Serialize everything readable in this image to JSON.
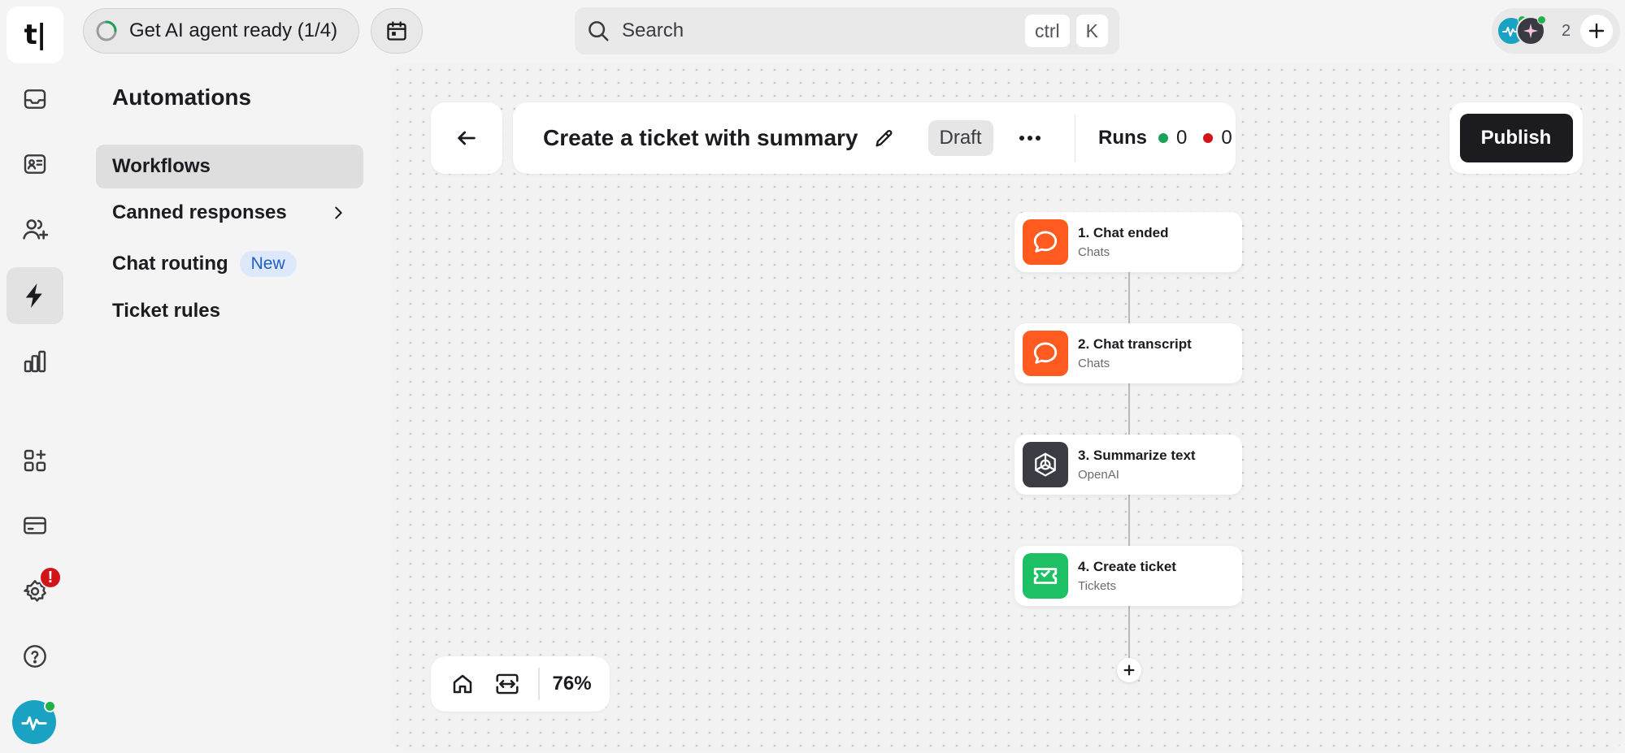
{
  "app": {
    "logo_text": "t|"
  },
  "topbar": {
    "onboarding_label": "Get AI agent ready (1/4)",
    "onboarding_progress": 0.25,
    "search_placeholder": "Search",
    "shortcut_keys": [
      "ctrl",
      "K"
    ],
    "presence_count": "2"
  },
  "rail": {
    "items": [
      {
        "name": "inbox-icon",
        "active": false
      },
      {
        "name": "contacts-card-icon",
        "active": false
      },
      {
        "name": "add-user-icon",
        "active": false
      },
      {
        "name": "lightning-icon",
        "active": true
      },
      {
        "name": "bar-chart-icon",
        "active": false
      },
      {
        "name": "apps-icon",
        "active": false
      },
      {
        "name": "billing-card-icon",
        "active": false
      },
      {
        "name": "gear-icon",
        "active": false
      },
      {
        "name": "help-icon",
        "active": false
      }
    ],
    "settings_badge": "!"
  },
  "subnav": {
    "title": "Automations",
    "items": [
      {
        "label": "Workflows",
        "active": true
      },
      {
        "label": "Canned responses",
        "has_chevron": true
      },
      {
        "label": "Chat routing",
        "pill": "New"
      },
      {
        "label": "Ticket rules"
      }
    ]
  },
  "workflow": {
    "name": "Create a ticket with summary",
    "status": "Draft",
    "runs_label": "Runs",
    "runs_success": "0",
    "runs_failed": "0",
    "publish_label": "Publish"
  },
  "nodes": [
    {
      "title": "1. Chat ended",
      "subtitle": "Chats",
      "icon": "chat-bubble-icon",
      "color": "#ff5a1f"
    },
    {
      "title": "2. Chat transcript",
      "subtitle": "Chats",
      "icon": "chat-bubble-icon",
      "color": "#ff5a1f"
    },
    {
      "title": "3. Summarize text",
      "subtitle": "OpenAI",
      "icon": "openai-icon",
      "color": "#3b3b44"
    },
    {
      "title": "4. Create ticket",
      "subtitle": "Tickets",
      "icon": "ticket-icon",
      "color": "#1ec065"
    }
  ],
  "zoom": {
    "level": "76%"
  },
  "colors": {
    "accent_dark": "#1b1b20",
    "success": "#1aa25a",
    "danger": "#d21419",
    "canvas_bg": "#f2f2f2"
  }
}
